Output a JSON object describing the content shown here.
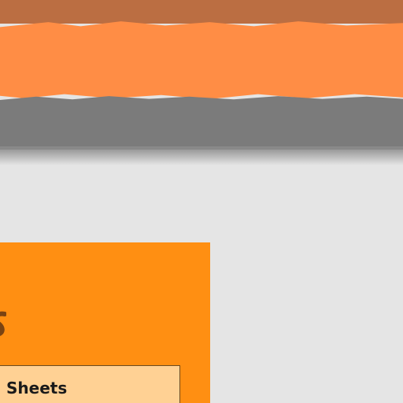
{
  "banner": {
    "colors": {
      "top": "#bb6e42",
      "orange": "#ff8d45",
      "gray": "#7b7b7b"
    }
  },
  "card": {
    "color": "#ff8f12",
    "edge_icon": "decorative-glyph-icon",
    "sheets_button": {
      "label": "Sheets",
      "color": "#ffd194"
    }
  },
  "background": "#e5e5e5"
}
